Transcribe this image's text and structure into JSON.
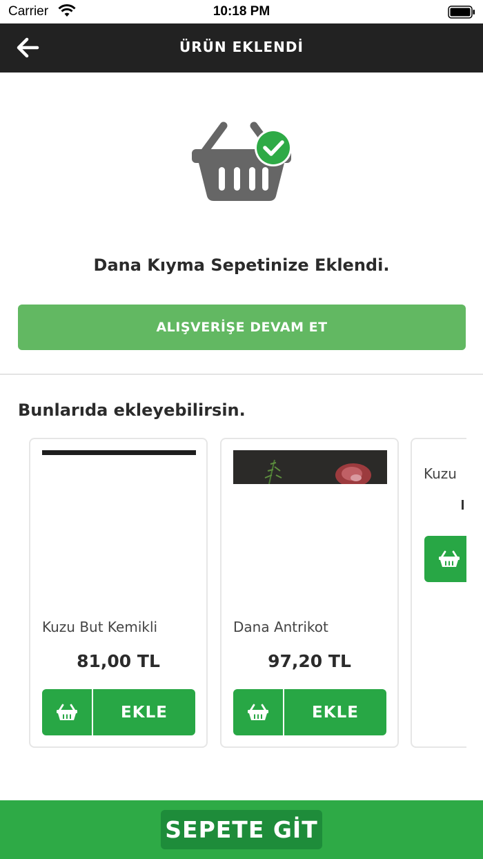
{
  "status_bar": {
    "carrier": "Carrier",
    "time": "10:18 PM"
  },
  "nav": {
    "title": "ÜRÜN EKLENDİ",
    "back_icon": "arrow-left-icon"
  },
  "confirmation": {
    "icon": "basket-check-icon",
    "message": "Dana Kıyma Sepetinize Eklendi.",
    "continue_label": "ALIŞVERİŞE DEVAM ET"
  },
  "suggestions": {
    "title": "Bunlarıda ekleyebilirsin.",
    "items": [
      {
        "name": "Kuzu But Kemikli",
        "price": "81,00 TL",
        "add_label": "EKLE"
      },
      {
        "name": "Dana Antrikot",
        "price": "97,20 TL",
        "add_label": "EKLE"
      },
      {
        "name": "Kuzu"
      }
    ]
  },
  "footer": {
    "checkout_label": "SEPETE GİT"
  },
  "colors": {
    "nav_bg": "#222222",
    "continue_green": "#62b862",
    "add_green": "#28a745",
    "footer_green": "#2eaa46",
    "checkout_green": "#1e8c3a",
    "icon_gray": "#666666"
  }
}
